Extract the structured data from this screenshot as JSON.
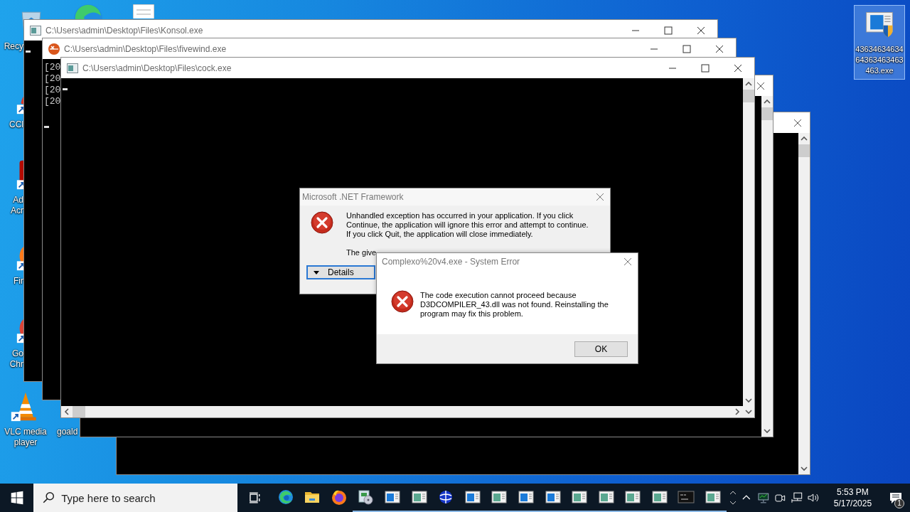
{
  "desktop_icons": [
    {
      "kind": "recycle-bin",
      "selected": false,
      "label": [
        "Recy"
      ]
    },
    {
      "kind": "edge",
      "selected": false
    },
    {
      "kind": "document",
      "selected": false
    },
    {
      "kind": "ccleaner",
      "selected": false,
      "label": [
        "CCl"
      ]
    },
    {
      "kind": "acrobat",
      "selected": false,
      "label": [
        "Ad",
        "Acr"
      ]
    },
    {
      "kind": "firefox",
      "selected": false,
      "label": [
        "Fir"
      ]
    },
    {
      "kind": "chrome",
      "selected": false,
      "label": [
        "Go",
        "Chr"
      ]
    },
    {
      "kind": "vlc",
      "selected": false,
      "label": [
        "VLC media",
        "player"
      ]
    },
    {
      "kind": "hidden",
      "selected": false,
      "label": [
        "goald"
      ]
    },
    {
      "kind": "installer",
      "selected": true,
      "label": [
        "43634634634",
        "64363463463",
        "463.exe"
      ]
    }
  ],
  "windows": [
    {
      "kind": "console",
      "title": "C:\\Users\\admin\\Desktop\\Files\\Konsol.exe"
    },
    {
      "kind": "xr",
      "title": "C:\\Users\\admin\\Desktop\\Files\\fivewind.exe",
      "lines": [
        "[20",
        "[20",
        "[20",
        "[20"
      ]
    },
    {
      "kind": "console",
      "title": "C:\\Users\\admin\\Desktop\\Files\\cock.exe"
    },
    {
      "kind": "blank"
    },
    {
      "kind": "blank"
    }
  ],
  "net_dialog": {
    "title": "Microsoft .NET Framework",
    "message": "Unhandled exception has occurred in your application. If you click Continue, the application will ignore this error and attempt to continue. If you click Quit, the application will close immediately.",
    "detail": "The give",
    "details_button": "Details"
  },
  "error_dialog": {
    "title": "Complexo%20v4.exe - System Error",
    "message": "The code execution cannot proceed because D3DCOMPILER_43.dll was not found. Reinstalling the program may fix this problem.",
    "ok_button": "OK"
  },
  "taskbar": {
    "search_placeholder": "Type here to search",
    "apps": [
      {
        "kind": "edge",
        "running": false
      },
      {
        "kind": "folder",
        "running": false
      },
      {
        "kind": "firefox",
        "running": false
      },
      {
        "kind": "installer",
        "running": true
      },
      {
        "kind": "window-blue",
        "running": true
      },
      {
        "kind": "window-green",
        "running": true
      },
      {
        "kind": "globe",
        "running": true
      },
      {
        "kind": "window-blue",
        "running": true
      },
      {
        "kind": "window-green",
        "running": true
      },
      {
        "kind": "window-blue",
        "running": true
      },
      {
        "kind": "window-blue",
        "running": true
      },
      {
        "kind": "window-green",
        "running": true
      },
      {
        "kind": "window-green",
        "running": true
      },
      {
        "kind": "window-green",
        "running": true
      },
      {
        "kind": "window-green",
        "running": true
      },
      {
        "kind": "console",
        "running": true
      },
      {
        "kind": "window-green",
        "running": true
      }
    ],
    "clock": {
      "time": "5:53 PM",
      "date": "5/17/2025"
    },
    "notification_count": "1"
  }
}
